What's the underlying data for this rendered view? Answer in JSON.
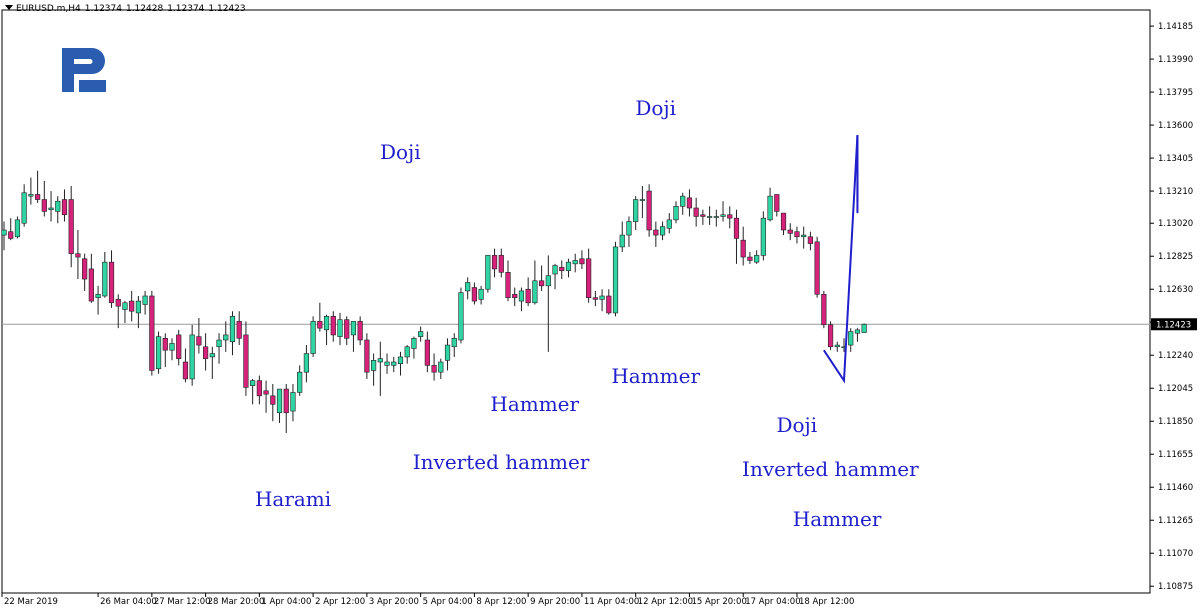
{
  "header": {
    "symbol": "EURUSD.m,H4",
    "ohlc": [
      "1.12374",
      "1.12428",
      "1.12374",
      "1.12423"
    ]
  },
  "colors": {
    "bull": "#2fd4a3",
    "bear": "#d6227a",
    "wick": "#222222",
    "arrow": "#1f1fcc",
    "annotation": "#1f1fcc",
    "logo": "#2a5db0"
  },
  "annotations": [
    {
      "text": "Doji",
      "x": "4 Apr 16:00",
      "y": 1.1344
    },
    {
      "text": "Doji",
      "x": "15 Apr 00:00",
      "y": 1.137
    },
    {
      "text": "Hammer",
      "x": "10 Apr 00:00",
      "y": 1.1195
    },
    {
      "text": "Hammer",
      "x": "15 Apr 00:00",
      "y": 1.1212
    },
    {
      "text": "Inverted hammer",
      "x": "9 Apr 04:00",
      "y": 1.1161
    },
    {
      "text": "Harami",
      "x": "2 Apr 00:00",
      "y": 1.1139
    },
    {
      "text": "Doji",
      "x": "18 Apr 12:00",
      "y": 1.1183
    },
    {
      "text": "Inverted hammer",
      "x": "19 Apr 08:00",
      "y": 1.1157
    },
    {
      "text": "Hammer",
      "x": "19 Apr 12:00",
      "y": 1.1127
    }
  ],
  "chart_data": {
    "type": "candlestick",
    "timeframe": "H4",
    "x_tick_labels": [
      "22 Mar 2019",
      "26 Mar 04:00",
      "27 Mar 12:00",
      "28 Mar 20:00",
      "1 Apr 04:00",
      "2 Apr 12:00",
      "3 Apr 20:00",
      "5 Apr 04:00",
      "8 Apr 12:00",
      "9 Apr 20:00",
      "11 Apr 04:00",
      "12 Apr 12:00",
      "15 Apr 20:00",
      "17 Apr 04:00",
      "18 Apr 12:00"
    ],
    "y_tick_labels": [
      "1.14185",
      "1.13990",
      "1.13795",
      "1.13600",
      "1.13405",
      "1.13210",
      "1.13020",
      "1.12825",
      "1.12630",
      "1.12435",
      "1.12240",
      "1.12045",
      "1.11850",
      "1.11655",
      "1.11460",
      "1.11265",
      "1.11070",
      "1.10875"
    ],
    "ylim": [
      1.10835,
      1.1428
    ],
    "current_price": 1.12423,
    "current_price_label": "1.12423",
    "grid": false,
    "candles": [
      [
        1.1295,
        1.1303,
        1.1286,
        1.1298
      ],
      [
        1.1297,
        1.1305,
        1.1292,
        1.1293
      ],
      [
        1.1294,
        1.1306,
        1.1293,
        1.1304
      ],
      [
        1.1302,
        1.1325,
        1.13,
        1.132
      ],
      [
        1.1318,
        1.1329,
        1.1313,
        1.1319
      ],
      [
        1.1319,
        1.1333,
        1.1314,
        1.1316
      ],
      [
        1.1316,
        1.1327,
        1.1306,
        1.1309
      ],
      [
        1.131,
        1.1321,
        1.1303,
        1.1311
      ],
      [
        1.1309,
        1.1318,
        1.1302,
        1.1315
      ],
      [
        1.1316,
        1.1322,
        1.1303,
        1.1307
      ],
      [
        1.1316,
        1.1324,
        1.1276,
        1.1284
      ],
      [
        1.1284,
        1.1298,
        1.1269,
        1.1282
      ],
      [
        1.1281,
        1.1284,
        1.1262,
        1.1269
      ],
      [
        1.1275,
        1.1284,
        1.1255,
        1.1256
      ],
      [
        1.1258,
        1.1265,
        1.1248,
        1.126
      ],
      [
        1.1259,
        1.1285,
        1.1258,
        1.1279
      ],
      [
        1.1279,
        1.1286,
        1.1252,
        1.1255
      ],
      [
        1.1257,
        1.126,
        1.124,
        1.1253
      ],
      [
        1.1251,
        1.1256,
        1.1243,
        1.1255
      ],
      [
        1.1256,
        1.1262,
        1.1244,
        1.125
      ],
      [
        1.1249,
        1.1259,
        1.124,
        1.1256
      ],
      [
        1.1254,
        1.1262,
        1.1248,
        1.1259
      ],
      [
        1.1259,
        1.1262,
        1.1212,
        1.1215
      ],
      [
        1.1216,
        1.1238,
        1.1213,
        1.1235
      ],
      [
        1.1234,
        1.1237,
        1.1217,
        1.1227
      ],
      [
        1.1227,
        1.1234,
        1.1221,
        1.1231
      ],
      [
        1.1236,
        1.1239,
        1.1218,
        1.1222
      ],
      [
        1.122,
        1.1228,
        1.1208,
        1.121
      ],
      [
        1.121,
        1.1242,
        1.1206,
        1.1236
      ],
      [
        1.1235,
        1.1246,
        1.1225,
        1.123
      ],
      [
        1.1229,
        1.1237,
        1.1215,
        1.1222
      ],
      [
        1.1223,
        1.1229,
        1.121,
        1.1225
      ],
      [
        1.1229,
        1.1237,
        1.1219,
        1.1233
      ],
      [
        1.1233,
        1.1244,
        1.1226,
        1.1236
      ],
      [
        1.1232,
        1.125,
        1.1224,
        1.1247
      ],
      [
        1.1244,
        1.125,
        1.123,
        1.1234
      ],
      [
        1.1236,
        1.1244,
        1.12,
        1.1205
      ],
      [
        1.1206,
        1.121,
        1.1195,
        1.1209
      ],
      [
        1.1209,
        1.1212,
        1.1195,
        1.12
      ],
      [
        1.1203,
        1.1209,
        1.119,
        1.1201
      ],
      [
        1.12,
        1.1207,
        1.1185,
        1.1195
      ],
      [
        1.119,
        1.1204,
        1.1184,
        1.1204
      ],
      [
        1.1204,
        1.1207,
        1.1178,
        1.119
      ],
      [
        1.1191,
        1.1207,
        1.1185,
        1.1202
      ],
      [
        1.1202,
        1.1218,
        1.12,
        1.1214
      ],
      [
        1.1214,
        1.123,
        1.1208,
        1.1225
      ],
      [
        1.1225,
        1.1247,
        1.1223,
        1.1244
      ],
      [
        1.1244,
        1.1255,
        1.1238,
        1.124
      ],
      [
        1.1239,
        1.1248,
        1.123,
        1.1247
      ],
      [
        1.1247,
        1.125,
        1.1232,
        1.1236
      ],
      [
        1.1235,
        1.1249,
        1.123,
        1.1245
      ],
      [
        1.1245,
        1.1247,
        1.123,
        1.1234
      ],
      [
        1.1236,
        1.1244,
        1.1226,
        1.1244
      ],
      [
        1.1244,
        1.1247,
        1.123,
        1.1233
      ],
      [
        1.1233,
        1.1237,
        1.121,
        1.1214
      ],
      [
        1.1215,
        1.1225,
        1.1206,
        1.1221
      ],
      [
        1.122,
        1.1232,
        1.12,
        1.1222
      ],
      [
        1.1218,
        1.1225,
        1.1213,
        1.122
      ],
      [
        1.1218,
        1.1223,
        1.1214,
        1.122
      ],
      [
        1.1219,
        1.1226,
        1.1212,
        1.1223
      ],
      [
        1.1223,
        1.123,
        1.1219,
        1.1229
      ],
      [
        1.1228,
        1.1235,
        1.1222,
        1.1234
      ],
      [
        1.1235,
        1.1241,
        1.1232,
        1.1238
      ],
      [
        1.1233,
        1.1238,
        1.1214,
        1.1218
      ],
      [
        1.1218,
        1.1225,
        1.1209,
        1.1214
      ],
      [
        1.1214,
        1.1222,
        1.121,
        1.122
      ],
      [
        1.1221,
        1.1234,
        1.1215,
        1.123
      ],
      [
        1.1229,
        1.1237,
        1.1223,
        1.1234
      ],
      [
        1.1233,
        1.1264,
        1.1231,
        1.1261
      ],
      [
        1.1262,
        1.127,
        1.1257,
        1.1267
      ],
      [
        1.1264,
        1.1267,
        1.1254,
        1.1256
      ],
      [
        1.1257,
        1.1265,
        1.1254,
        1.1263
      ],
      [
        1.1263,
        1.1278,
        1.1261,
        1.1283
      ],
      [
        1.1283,
        1.1287,
        1.127,
        1.1275
      ],
      [
        1.1283,
        1.1287,
        1.127,
        1.1273
      ],
      [
        1.1273,
        1.128,
        1.1256,
        1.1258
      ],
      [
        1.126,
        1.1264,
        1.1253,
        1.1258
      ],
      [
        1.1256,
        1.1264,
        1.125,
        1.1262
      ],
      [
        1.1263,
        1.127,
        1.1253,
        1.1255
      ],
      [
        1.1255,
        1.128,
        1.1254,
        1.1268
      ],
      [
        1.1268,
        1.1277,
        1.1262,
        1.1265
      ],
      [
        1.1265,
        1.1283,
        1.1226,
        1.1271
      ],
      [
        1.1272,
        1.1278,
        1.1263,
        1.1277
      ],
      [
        1.1276,
        1.128,
        1.1269,
        1.1274
      ],
      [
        1.1274,
        1.1281,
        1.127,
        1.1279
      ],
      [
        1.1278,
        1.1284,
        1.1273,
        1.128
      ],
      [
        1.1281,
        1.1286,
        1.1275,
        1.1278
      ],
      [
        1.1281,
        1.1287,
        1.1255,
        1.1258
      ],
      [
        1.1258,
        1.1262,
        1.1253,
        1.1257
      ],
      [
        1.1257,
        1.1263,
        1.125,
        1.1259
      ],
      [
        1.1259,
        1.1263,
        1.1248,
        1.1249
      ],
      [
        1.1249,
        1.1291,
        1.1247,
        1.1288
      ],
      [
        1.1288,
        1.1303,
        1.1285,
        1.1295
      ],
      [
        1.1295,
        1.1306,
        1.1288,
        1.1303
      ],
      [
        1.1303,
        1.1318,
        1.1298,
        1.1316
      ],
      [
        1.1316,
        1.1324,
        1.1305,
        1.1316
      ],
      [
        1.1321,
        1.1325,
        1.1294,
        1.1298
      ],
      [
        1.1298,
        1.1303,
        1.1288,
        1.1295
      ],
      [
        1.1295,
        1.1303,
        1.1292,
        1.13
      ],
      [
        1.1299,
        1.1308,
        1.1296,
        1.1304
      ],
      [
        1.1304,
        1.1315,
        1.1302,
        1.1312
      ],
      [
        1.1312,
        1.132,
        1.1307,
        1.1318
      ],
      [
        1.1317,
        1.1322,
        1.1306,
        1.1311
      ],
      [
        1.1311,
        1.1317,
        1.13,
        1.1306
      ],
      [
        1.1307,
        1.131,
        1.1301,
        1.1306
      ],
      [
        1.1306,
        1.1312,
        1.1301,
        1.1306
      ],
      [
        1.1306,
        1.131,
        1.13,
        1.1306
      ],
      [
        1.1306,
        1.1315,
        1.1303,
        1.1307
      ],
      [
        1.1307,
        1.1312,
        1.1299,
        1.1305
      ],
      [
        1.1305,
        1.131,
        1.1278,
        1.1293
      ],
      [
        1.1292,
        1.13,
        1.1277,
        1.1282
      ],
      [
        1.1282,
        1.1285,
        1.1278,
        1.128
      ],
      [
        1.1279,
        1.1286,
        1.1278,
        1.1283
      ],
      [
        1.1283,
        1.1309,
        1.128,
        1.1305
      ],
      [
        1.1304,
        1.1323,
        1.1303,
        1.1318
      ],
      [
        1.1319,
        1.1319,
        1.1306,
        1.1309
      ],
      [
        1.1308,
        1.1303,
        1.1295,
        1.1298
      ],
      [
        1.1298,
        1.1302,
        1.1292,
        1.1296
      ],
      [
        1.1297,
        1.13,
        1.129,
        1.1294
      ],
      [
        1.1294,
        1.13,
        1.1287,
        1.1295
      ],
      [
        1.1294,
        1.1297,
        1.1286,
        1.129
      ],
      [
        1.1291,
        1.1294,
        1.1258,
        1.126
      ],
      [
        1.126,
        1.1262,
        1.124,
        1.1242
      ],
      [
        1.1242,
        1.1244,
        1.1227,
        1.1229
      ],
      [
        1.1229,
        1.1232,
        1.1226,
        1.123
      ],
      [
        1.1229,
        1.1234,
        1.1226,
        1.1229
      ],
      [
        1.123,
        1.124,
        1.1226,
        1.1238
      ],
      [
        1.1237,
        1.124,
        1.1232,
        1.1239
      ],
      [
        1.12374,
        1.12428,
        1.12374,
        1.12423
      ]
    ],
    "drawn_projection": {
      "points": [
        [
          "19 Apr 04:00",
          1.1227
        ],
        [
          "19 Apr 16:00",
          1.1209
        ],
        [
          "21 Apr 16:00",
          1.1354
        ]
      ],
      "arrowhead_left": [
        "21 Apr 00:00",
        1.1315
      ],
      "arrowhead_right": [
        "21 Apr 04:00",
        1.1308
      ]
    }
  }
}
